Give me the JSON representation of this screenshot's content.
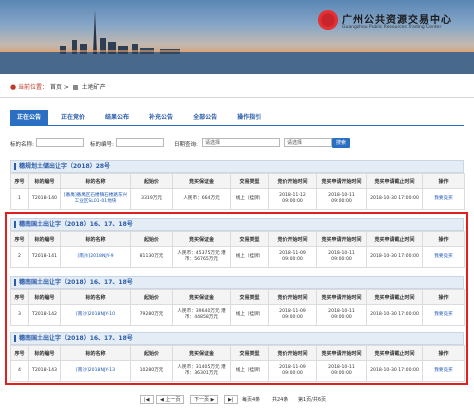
{
  "header": {
    "org_name_cn": "广州公共资源交易中心",
    "org_name_en": "Guangzhou Public Resources Trading Center"
  },
  "breadcrumb": {
    "label": "当前位置：",
    "home": "首页",
    "sep": ">",
    "current": "土地矿产"
  },
  "tabs": [
    {
      "label": "正在公告",
      "active": true
    },
    {
      "label": "正在竞价",
      "active": false
    },
    {
      "label": "结果公布",
      "active": false
    },
    {
      "label": "补充公告",
      "active": false
    },
    {
      "label": "全部公告",
      "active": false
    },
    {
      "label": "操作指引",
      "active": false
    }
  ],
  "filter": {
    "name_label": "标的名称:",
    "number_label": "标的编号:",
    "date_label": "日期查询:",
    "date_placeholder": "请选择",
    "region_placeholder": "请选择",
    "search_button": "搜索"
  },
  "columns": [
    "序号",
    "标的编号",
    "标的名称",
    "起始价",
    "竞买保证金",
    "交易类型",
    "竞价开始时间",
    "竞买申请开始时间",
    "竞买申请截止时间",
    "操作"
  ],
  "sections": [
    {
      "title": "穗规划土储出让字（2018）28号",
      "rows": [
        {
          "no": "1",
          "code": "T2018-140",
          "name": "[番禺]番禺区石楼镇石楼路东兴工业区SL01-01地块",
          "price": "3319万元",
          "deposit": "人民币：664万元",
          "type": "线上（挂牌）",
          "start": "2018-11-12 09:00:00",
          "apply_start": "2018-10-11 09:00:00",
          "apply_end": "2018-10-30 17:00:00",
          "op": "我要竞买"
        }
      ]
    },
    {
      "title": "穗南国土出让字（2018）16、17、18号",
      "rows": [
        {
          "no": "2",
          "code": "T2018-141",
          "name": "[南沙]2018NJY-9",
          "price": "81130万元",
          "deposit": "人民币：45375万元 港币：56765万元",
          "type": "线上（挂牌）",
          "start": "2018-11-09 09:00:00",
          "apply_start": "2018-10-11 09:00:00",
          "apply_end": "2018-10-30 17:00:00",
          "op": "我要竞买"
        }
      ]
    },
    {
      "title": "穗南国土出让字（2018）16、17、18号",
      "rows": [
        {
          "no": "3",
          "code": "T2018-142",
          "name": "[南沙]2018NJY-10",
          "price": "79280万元",
          "deposit": "人民币：39640万元 港币：44858万元",
          "type": "线上（挂牌）",
          "start": "2018-11-09 09:00:00",
          "apply_start": "2018-10-11 09:00:00",
          "apply_end": "2018-10-30 17:00:00",
          "op": "我要竞买"
        }
      ]
    },
    {
      "title": "穗南国土出让字（2018）16、17、18号",
      "rows": [
        {
          "no": "4",
          "code": "T2018-143",
          "name": "[南沙]2018NJY-13",
          "price": "10280万元",
          "deposit": "人民币：31405万元 港币：36301万元",
          "type": "线上（挂牌）",
          "start": "2018-11-09 09:00:00",
          "apply_start": "2018-10-11 09:00:00",
          "apply_end": "2018-10-30 17:00:00",
          "op": "我要竞买"
        }
      ]
    }
  ],
  "pager": {
    "prev": "上一页",
    "next": "下一页",
    "per_page": "每页4条",
    "total": "共24条",
    "page_info": "第1页/共6页"
  },
  "colors": {
    "accent": "#2a6fc1",
    "highlight_border": "#e02020"
  }
}
